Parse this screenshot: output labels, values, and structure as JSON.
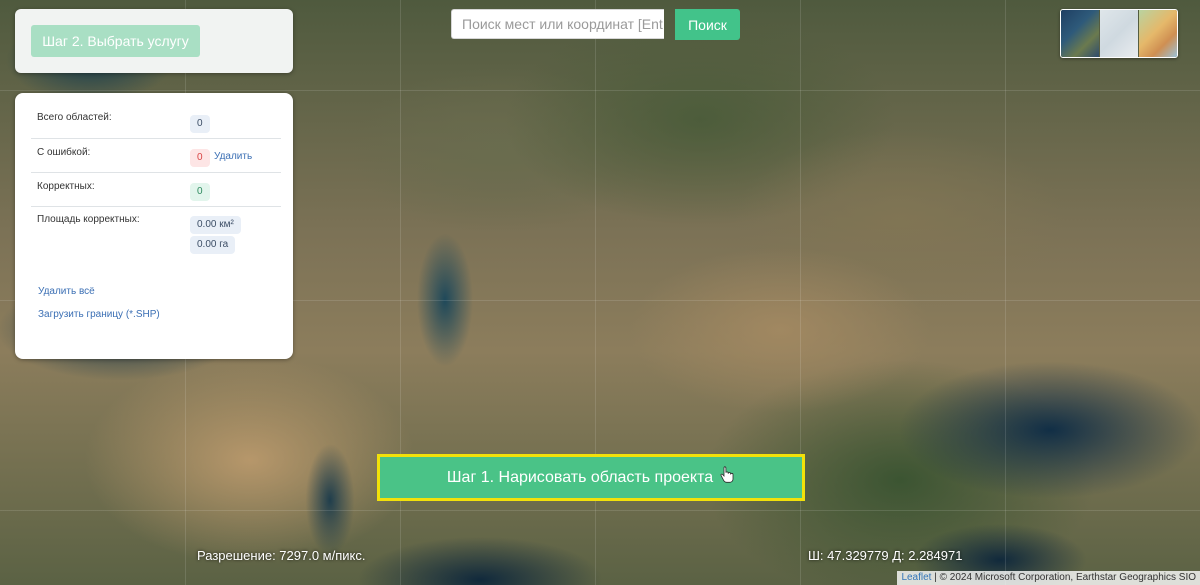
{
  "step2": {
    "label": "Шаг 2. Выбрать услугу"
  },
  "search": {
    "placeholder": "Поиск мест или координат [Ent",
    "button": "Поиск"
  },
  "stats": {
    "total_label": "Всего областей:",
    "total_value": "0",
    "error_label": "С ошибкой:",
    "error_value": "0",
    "delete_label": "Удалить",
    "correct_label": "Корректных:",
    "correct_value": "0",
    "area_label": "Площадь корректных:",
    "area_km2": "0.00 км²",
    "area_ha": "0.00 га",
    "delete_all": "Удалить всё",
    "upload_shp": "Загрузить границу (*.SHP)"
  },
  "step1": {
    "label": "Шаг 1. Нарисовать область проекта",
    "icon": "pointer-hand-icon"
  },
  "resolution": "Разрешение: 7297.0 м/пикс.",
  "coords": "Ш: 47.329779 Д: 2.284971",
  "attribution": {
    "leaflet": "Leaflet",
    "text": "| © 2024 Microsoft Corporation, Earthstar Geographics SIO"
  },
  "colors": {
    "accent": "#42c38a",
    "highlight": "#f2e10a",
    "error": "#d94545"
  }
}
